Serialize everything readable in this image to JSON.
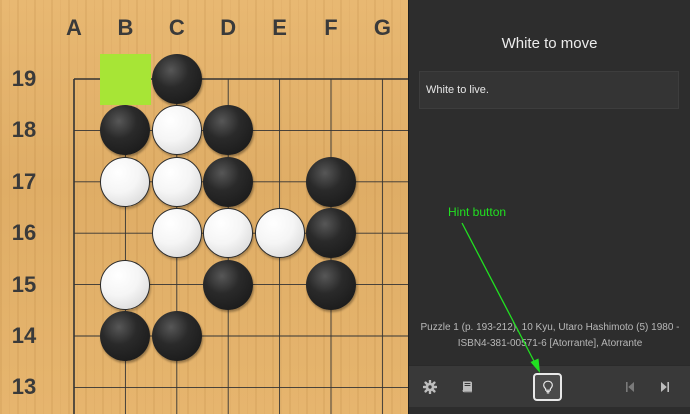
{
  "board": {
    "columns": [
      "A",
      "B",
      "C",
      "D",
      "E",
      "F",
      "G"
    ],
    "rows": [
      "19",
      "18",
      "17",
      "16",
      "15",
      "14",
      "13"
    ],
    "highlight": {
      "col": "B",
      "row": "19",
      "color": "#a7e536"
    },
    "stones": [
      {
        "color": "black",
        "col": "C",
        "row": "19"
      },
      {
        "color": "black",
        "col": "B",
        "row": "18"
      },
      {
        "color": "white",
        "col": "C",
        "row": "18"
      },
      {
        "color": "black",
        "col": "D",
        "row": "18"
      },
      {
        "color": "white",
        "col": "B",
        "row": "17"
      },
      {
        "color": "white",
        "col": "C",
        "row": "17"
      },
      {
        "color": "black",
        "col": "D",
        "row": "17"
      },
      {
        "color": "black",
        "col": "F",
        "row": "17"
      },
      {
        "color": "white",
        "col": "C",
        "row": "16"
      },
      {
        "color": "white",
        "col": "D",
        "row": "16"
      },
      {
        "color": "white",
        "col": "E",
        "row": "16"
      },
      {
        "color": "black",
        "col": "F",
        "row": "16"
      },
      {
        "color": "white",
        "col": "B",
        "row": "15"
      },
      {
        "color": "black",
        "col": "D",
        "row": "15"
      },
      {
        "color": "black",
        "col": "F",
        "row": "15"
      },
      {
        "color": "black",
        "col": "B",
        "row": "14"
      },
      {
        "color": "black",
        "col": "C",
        "row": "14"
      }
    ]
  },
  "panel": {
    "title": "White to move",
    "comment": "White to live.",
    "source": "Puzzle 1 (p. 193-212), 10 Kyu, Utaro Hashimoto (5) 1980 - ISBN4-381-00571-6 [Atorrante], Atorrante"
  },
  "toolbar": {
    "settings_icon": "gear-icon",
    "book_icon": "book-icon",
    "hint_icon": "lightbulb-icon",
    "first_icon": "skip-to-start-icon",
    "next_icon": "skip-forward-icon"
  },
  "annotation": {
    "label": "Hint button",
    "color": "#21e021"
  }
}
